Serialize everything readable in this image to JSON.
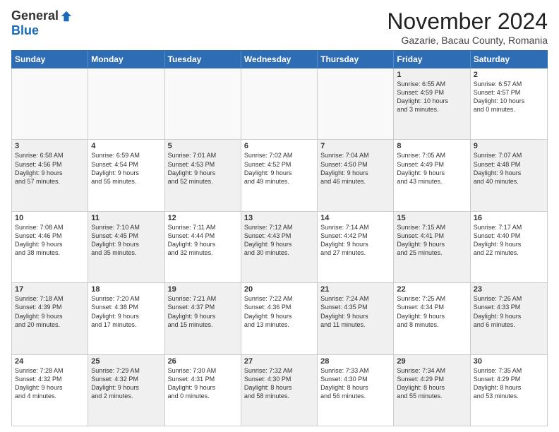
{
  "header": {
    "logo_general": "General",
    "logo_blue": "Blue",
    "month_title": "November 2024",
    "subtitle": "Gazarie, Bacau County, Romania"
  },
  "calendar": {
    "days_of_week": [
      "Sunday",
      "Monday",
      "Tuesday",
      "Wednesday",
      "Thursday",
      "Friday",
      "Saturday"
    ],
    "rows": [
      [
        {
          "day": "",
          "info": "",
          "empty": true
        },
        {
          "day": "",
          "info": "",
          "empty": true
        },
        {
          "day": "",
          "info": "",
          "empty": true
        },
        {
          "day": "",
          "info": "",
          "empty": true
        },
        {
          "day": "",
          "info": "",
          "empty": true
        },
        {
          "day": "1",
          "info": "Sunrise: 6:55 AM\nSunset: 4:59 PM\nDaylight: 10 hours\nand 3 minutes.",
          "shaded": true
        },
        {
          "day": "2",
          "info": "Sunrise: 6:57 AM\nSunset: 4:57 PM\nDaylight: 10 hours\nand 0 minutes.",
          "shaded": false
        }
      ],
      [
        {
          "day": "3",
          "info": "Sunrise: 6:58 AM\nSunset: 4:56 PM\nDaylight: 9 hours\nand 57 minutes.",
          "shaded": true
        },
        {
          "day": "4",
          "info": "Sunrise: 6:59 AM\nSunset: 4:54 PM\nDaylight: 9 hours\nand 55 minutes.",
          "shaded": false
        },
        {
          "day": "5",
          "info": "Sunrise: 7:01 AM\nSunset: 4:53 PM\nDaylight: 9 hours\nand 52 minutes.",
          "shaded": true
        },
        {
          "day": "6",
          "info": "Sunrise: 7:02 AM\nSunset: 4:52 PM\nDaylight: 9 hours\nand 49 minutes.",
          "shaded": false
        },
        {
          "day": "7",
          "info": "Sunrise: 7:04 AM\nSunset: 4:50 PM\nDaylight: 9 hours\nand 46 minutes.",
          "shaded": true
        },
        {
          "day": "8",
          "info": "Sunrise: 7:05 AM\nSunset: 4:49 PM\nDaylight: 9 hours\nand 43 minutes.",
          "shaded": false
        },
        {
          "day": "9",
          "info": "Sunrise: 7:07 AM\nSunset: 4:48 PM\nDaylight: 9 hours\nand 40 minutes.",
          "shaded": true
        }
      ],
      [
        {
          "day": "10",
          "info": "Sunrise: 7:08 AM\nSunset: 4:46 PM\nDaylight: 9 hours\nand 38 minutes.",
          "shaded": false
        },
        {
          "day": "11",
          "info": "Sunrise: 7:10 AM\nSunset: 4:45 PM\nDaylight: 9 hours\nand 35 minutes.",
          "shaded": true
        },
        {
          "day": "12",
          "info": "Sunrise: 7:11 AM\nSunset: 4:44 PM\nDaylight: 9 hours\nand 32 minutes.",
          "shaded": false
        },
        {
          "day": "13",
          "info": "Sunrise: 7:12 AM\nSunset: 4:43 PM\nDaylight: 9 hours\nand 30 minutes.",
          "shaded": true
        },
        {
          "day": "14",
          "info": "Sunrise: 7:14 AM\nSunset: 4:42 PM\nDaylight: 9 hours\nand 27 minutes.",
          "shaded": false
        },
        {
          "day": "15",
          "info": "Sunrise: 7:15 AM\nSunset: 4:41 PM\nDaylight: 9 hours\nand 25 minutes.",
          "shaded": true
        },
        {
          "day": "16",
          "info": "Sunrise: 7:17 AM\nSunset: 4:40 PM\nDaylight: 9 hours\nand 22 minutes.",
          "shaded": false
        }
      ],
      [
        {
          "day": "17",
          "info": "Sunrise: 7:18 AM\nSunset: 4:39 PM\nDaylight: 9 hours\nand 20 minutes.",
          "shaded": true
        },
        {
          "day": "18",
          "info": "Sunrise: 7:20 AM\nSunset: 4:38 PM\nDaylight: 9 hours\nand 17 minutes.",
          "shaded": false
        },
        {
          "day": "19",
          "info": "Sunrise: 7:21 AM\nSunset: 4:37 PM\nDaylight: 9 hours\nand 15 minutes.",
          "shaded": true
        },
        {
          "day": "20",
          "info": "Sunrise: 7:22 AM\nSunset: 4:36 PM\nDaylight: 9 hours\nand 13 minutes.",
          "shaded": false
        },
        {
          "day": "21",
          "info": "Sunrise: 7:24 AM\nSunset: 4:35 PM\nDaylight: 9 hours\nand 11 minutes.",
          "shaded": true
        },
        {
          "day": "22",
          "info": "Sunrise: 7:25 AM\nSunset: 4:34 PM\nDaylight: 9 hours\nand 8 minutes.",
          "shaded": false
        },
        {
          "day": "23",
          "info": "Sunrise: 7:26 AM\nSunset: 4:33 PM\nDaylight: 9 hours\nand 6 minutes.",
          "shaded": true
        }
      ],
      [
        {
          "day": "24",
          "info": "Sunrise: 7:28 AM\nSunset: 4:32 PM\nDaylight: 9 hours\nand 4 minutes.",
          "shaded": false
        },
        {
          "day": "25",
          "info": "Sunrise: 7:29 AM\nSunset: 4:32 PM\nDaylight: 9 hours\nand 2 minutes.",
          "shaded": true
        },
        {
          "day": "26",
          "info": "Sunrise: 7:30 AM\nSunset: 4:31 PM\nDaylight: 9 hours\nand 0 minutes.",
          "shaded": false
        },
        {
          "day": "27",
          "info": "Sunrise: 7:32 AM\nSunset: 4:30 PM\nDaylight: 8 hours\nand 58 minutes.",
          "shaded": true
        },
        {
          "day": "28",
          "info": "Sunrise: 7:33 AM\nSunset: 4:30 PM\nDaylight: 8 hours\nand 56 minutes.",
          "shaded": false
        },
        {
          "day": "29",
          "info": "Sunrise: 7:34 AM\nSunset: 4:29 PM\nDaylight: 8 hours\nand 55 minutes.",
          "shaded": true
        },
        {
          "day": "30",
          "info": "Sunrise: 7:35 AM\nSunset: 4:29 PM\nDaylight: 8 hours\nand 53 minutes.",
          "shaded": false
        }
      ]
    ]
  }
}
